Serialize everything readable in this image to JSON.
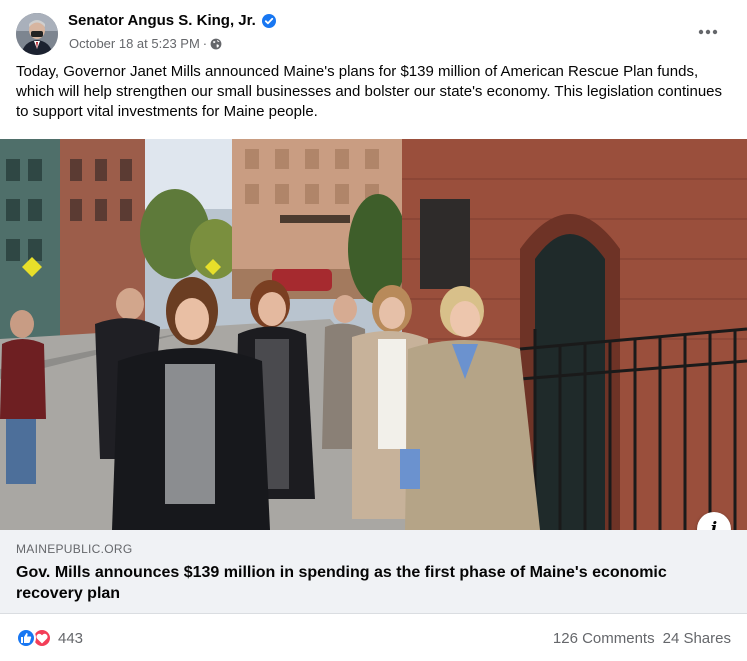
{
  "post": {
    "author": "Senator Angus S. King, Jr.",
    "timestamp": "October 18 at 5:23 PM",
    "separator": "·",
    "privacy_icon": "globe-icon",
    "text": "Today, Governor Janet Mills announced Maine's plans for $139 million of American Rescue Plan funds, which will help strengthen our small businesses and bolster our state's economy. This legislation continues to support vital investments for Maine people."
  },
  "link": {
    "domain": "MAINEPUBLIC.ORG",
    "title": "Gov. Mills announces $139 million in spending as the first phase of Maine's economic recovery plan"
  },
  "stats": {
    "reactions_count": "443",
    "reaction_icons": [
      "like-icon",
      "love-icon"
    ],
    "comments": "126 Comments",
    "shares": "24 Shares"
  },
  "colors": {
    "verified": "#1877f2",
    "like": "#1877f2",
    "love": "#f33e58",
    "link_card_bg": "#f0f2f5",
    "secondary_text": "#65676b"
  }
}
